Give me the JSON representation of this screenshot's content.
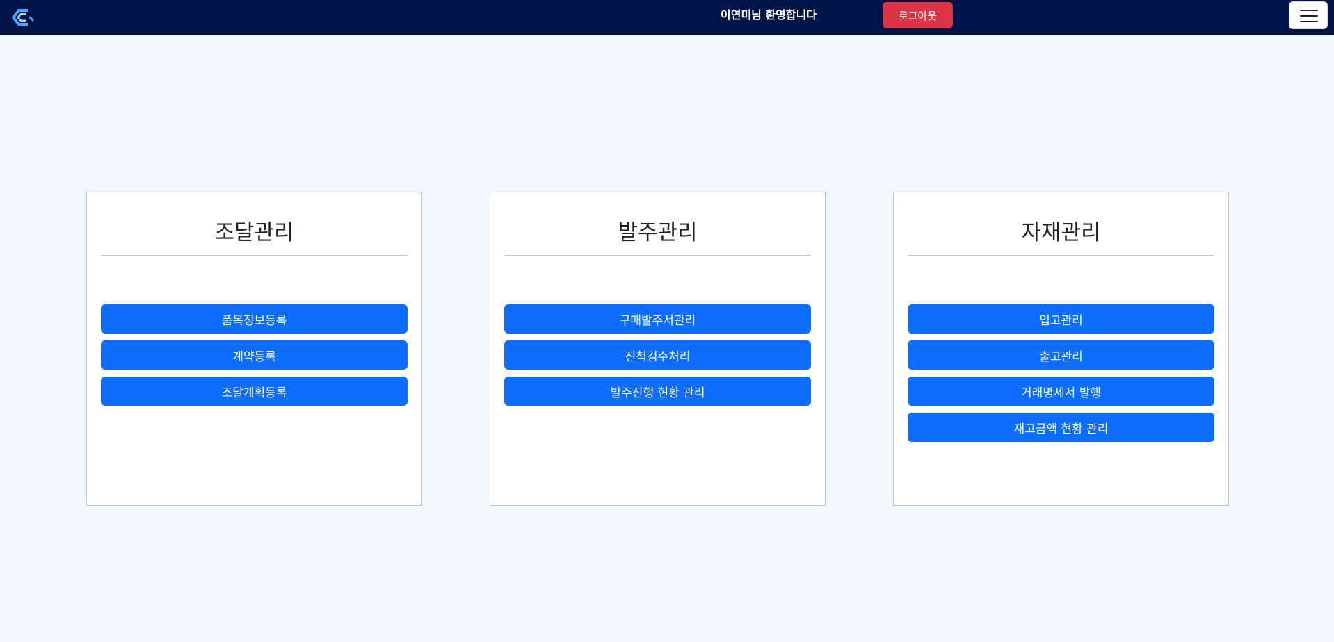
{
  "header": {
    "logo_icon": "c-logo-icon",
    "welcome_text": "이연미님 환영합니다",
    "logout_label": "로그아웃",
    "menu_icon": "hamburger-icon",
    "colors": {
      "bar": "#001447",
      "logout": "#dc3545",
      "primary": "#0d6efd",
      "page_bg": "#eff7ff"
    }
  },
  "cards": [
    {
      "title": "조달관리",
      "buttons": [
        "품목정보등록",
        "계약등록",
        "조달계획등록"
      ]
    },
    {
      "title": "발주관리",
      "buttons": [
        "구매발주서관리",
        "진척검수처리",
        "발주진행 현황 관리"
      ]
    },
    {
      "title": "자재관리",
      "buttons": [
        "입고관리",
        "출고관리",
        "거래명세서 발행",
        "재고금액 현황 관리"
      ]
    }
  ]
}
